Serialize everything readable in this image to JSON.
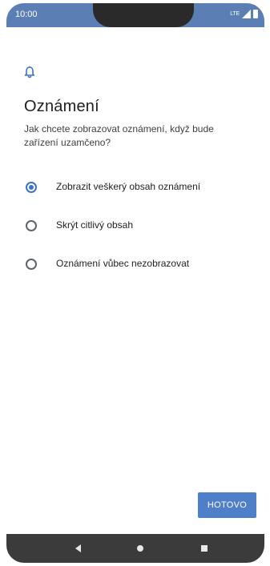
{
  "status_bar": {
    "time": "10:00",
    "network": "LTE",
    "icons": [
      "signal-icon",
      "battery-icon"
    ]
  },
  "header": {
    "icon": "bell-icon",
    "title": "Oznámení",
    "subtitle": "Jak chcete zobrazovat oznámení, když bude zařízení uzamčeno?"
  },
  "options": [
    {
      "label": "Zobrazit veškerý obsah oznámení",
      "selected": true
    },
    {
      "label": "Skrýt citlivý obsah",
      "selected": false
    },
    {
      "label": "Oznámení vůbec nezobrazovat",
      "selected": false
    }
  ],
  "actions": {
    "done_label": "HOTOVO"
  },
  "navigation": {
    "icons": [
      "back-icon",
      "home-icon",
      "recents-icon"
    ]
  },
  "colors": {
    "status_bar": "#5b7fb4",
    "accent": "#3b73c7",
    "button": "#4e7fc8",
    "nav_bar": "#3b3b3b"
  }
}
